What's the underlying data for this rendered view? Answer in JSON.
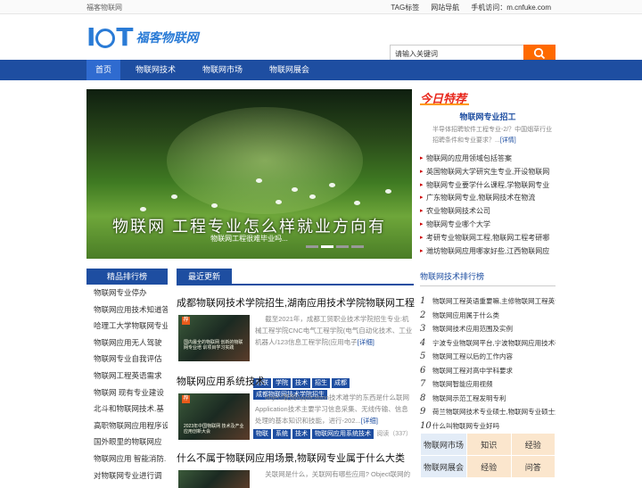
{
  "topbar": {
    "site": "福客物联网",
    "links": [
      "TAG标签",
      "网站导航",
      "手机访问：m.cnfuke.com"
    ]
  },
  "logo": {
    "iot": "IOT",
    "text": "福客物联网"
  },
  "search": {
    "value": "请输入关键词"
  },
  "nav": {
    "items": [
      "首页",
      "物联网技术",
      "物联网市场",
      "物联网展会"
    ]
  },
  "slider": {
    "big_text": "物联网 工程专业怎么样就业方向有",
    "caption": "物联网工程很难毕业吗...",
    "active_dot": 1
  },
  "rank": {
    "title": "精品排行榜",
    "items": [
      "物联网专业停办",
      "物联网应用技术知道答",
      "哈理工大学物联网专业",
      "物联网应用无人驾驶",
      "物联网专业自我评估",
      "物联网工程英语需求",
      "物联网 现有专业建设",
      "北斗和物联网技术.基",
      "高职物联网应用程序设",
      "国外眼里的物联网应",
      "物联网应用 智能消防.",
      "对物联网专业进行调"
    ]
  },
  "latest": {
    "tab": "最近更新",
    "articles": [
      {
        "title": "成都物联网技术学院招生,湖南应用技术学院物联网工程",
        "hot": "荐",
        "thumb_text": "国内最全的物联网 创新的物联网专业培 训项目学习实践",
        "desc": "截至2021年，成都工贸职业技术学院招生专业:机械工程学院CNC电气工程学院(电气自动化技术、工业机器人/123信息工程学院(应用电子",
        "more": "[详细]",
        "tags": [
          "物联",
          "学院",
          "技术",
          "招生",
          "成都",
          "成都物联网技术学院招生"
        ]
      },
      {
        "title": "物联网应用系统技术",
        "hot": "荐",
        "thumb_text": "2023年中国物联网 技术及产业应用创新大会",
        "desc": "object联网Application技术难学的东西是什么联网Application技术主要学习信息采集、无线传输、信息处理的基本知识和技能，进行-202...",
        "more": "[详细]",
        "tags": [
          "物联",
          "系统",
          "技术",
          "物联网应用系统技术"
        ],
        "views": "阅读（337）"
      },
      {
        "title": "什么不属于物联网应用场景,物联网专业属于什么大类",
        "desc": "关联网是什么，关联网有哪些应用? Object联网的"
      }
    ]
  },
  "today": {
    "logo": "今日特荐",
    "headline": "物联网专业招工",
    "text": "半导体招聘软件工程专业-2/？中国烟草行业招聘条件和专业要求？...",
    "more": "[详情]",
    "items": [
      "物联网的应用领域包括答案",
      "英国物联网大学研究生专业,开设物联网",
      "物联网专业要学什么课程,学物联网专业",
      "广东物联网专业,物联网技术在物流",
      "农业物联网技术公司",
      "物联网专业哪个大学",
      "考研专业物联网工程,物联网工程考研哪",
      "潍坊物联网应用哪家好些,江西物联网应"
    ]
  },
  "techrank": {
    "title": "物联网技术排行榜",
    "items": [
      "物联网工程英语重要嘛,主修物联网工程英语",
      "物联网应用属于什么类",
      "物联网技术应用范围及实例",
      "宁波专业物联网平台,宁波物联网应用技术研",
      "物联网工程以后的工作内容",
      "物联网工程对高中学科要求",
      "物联网智能应用视频",
      "物联网示范工程发明专利",
      "荷兰物联网技术专业硕士,物联网专业硕士大",
      "什么叫物联网专业好吗"
    ]
  },
  "grid": {
    "rows": [
      [
        "物联网市场",
        "知识",
        "经验"
      ],
      [
        "物联网展会",
        "经验",
        "问答"
      ]
    ]
  }
}
